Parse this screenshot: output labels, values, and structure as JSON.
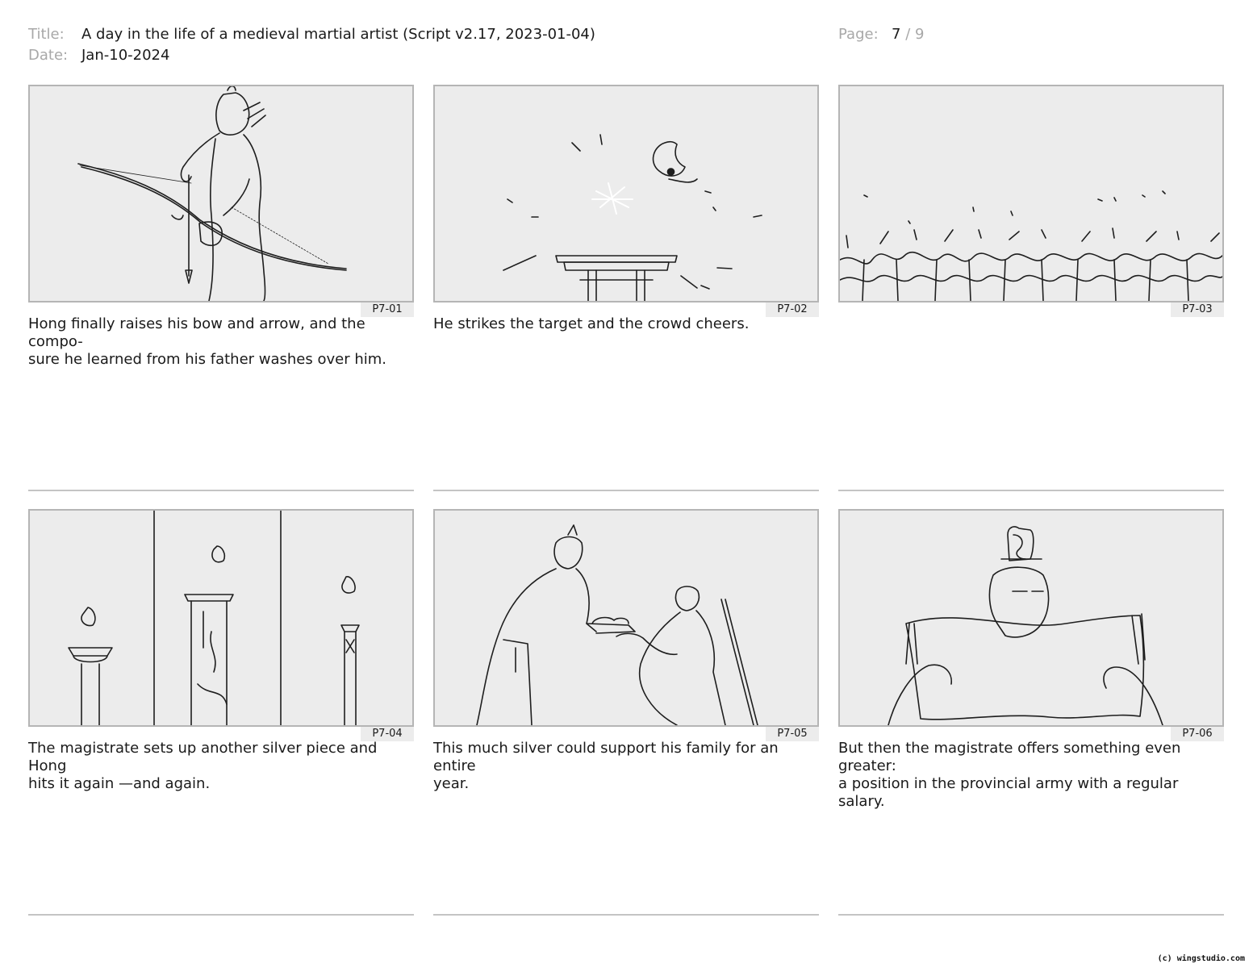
{
  "header": {
    "title_label": "Title:",
    "title_value": "A day in the life of a medieval martial artist (Script v2.17, 2023-01-04)",
    "date_label": "Date:",
    "date_value": "Jan-10-2024",
    "page_label": "Page:",
    "page_current": "7",
    "page_separator": "/",
    "page_total": "9"
  },
  "panels": [
    {
      "id": "P7-01",
      "caption": "Hong finally raises his bow and arrow, and the compo-sure he learned from his father washes over him.",
      "caption_lines": [
        "Hong finally raises his bow and arrow, and the compo-",
        "sure he learned from his father washes over him."
      ]
    },
    {
      "id": "P7-02",
      "caption": "He strikes the target and the crowd cheers.",
      "caption_lines": [
        "He strikes the target and the crowd cheers."
      ]
    },
    {
      "id": "P7-03",
      "caption": "",
      "caption_lines": [
        ""
      ]
    },
    {
      "id": "P7-04",
      "caption": "The magistrate sets up another silver piece and Hong hits it again —and again.",
      "caption_lines": [
        "The magistrate sets up another silver piece and Hong",
        "hits it again —and again."
      ]
    },
    {
      "id": "P7-05",
      "caption": "This much silver could support his family for an entire year.",
      "caption_lines": [
        "This much silver could support his family for an entire",
        "year."
      ]
    },
    {
      "id": "P7-06",
      "caption": "But then the magistrate offers something even greater: a position in the provincial army with a regular salary.",
      "caption_lines": [
        "But then the magistrate offers something even greater:",
        "a position in the provincial army with a regular salary."
      ]
    }
  ],
  "footer": {
    "credit": "(c) wingstudio.com"
  }
}
